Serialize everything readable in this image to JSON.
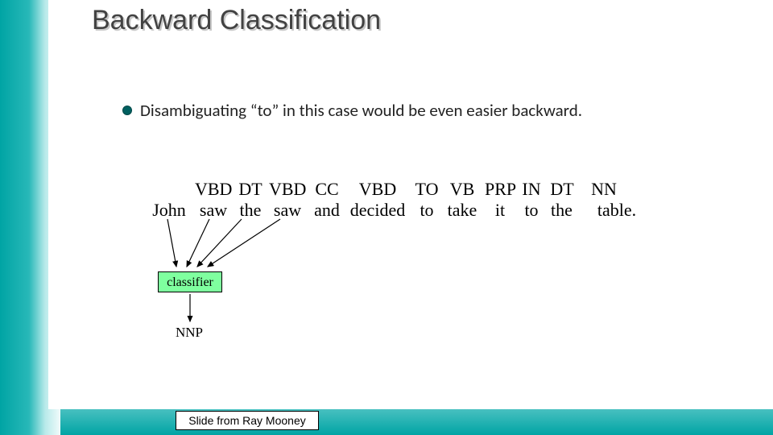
{
  "title": "Backward Classification",
  "bullet": "Disambiguating “to” in this case would be even easier backward.",
  "pos": {
    "c0": "",
    "c1": "VBD",
    "c2": "DT",
    "c3": "VBD",
    "c4": "CC",
    "c5": "VBD",
    "c6": "TO",
    "c7": "VB",
    "c8": "PRP",
    "c9": "IN",
    "c10": "DT",
    "c11": "NN"
  },
  "words": {
    "c0": "John",
    "c1": "saw",
    "c2": "the",
    "c3": "saw",
    "c4": "and",
    "c5": "decided",
    "c6": "to",
    "c7": "take",
    "c8": "it",
    "c9": "to",
    "c10": "the",
    "c11": "table."
  },
  "classifier_label": "classifier",
  "output_tag": "NNP",
  "footer": "Slide from Ray Mooney"
}
